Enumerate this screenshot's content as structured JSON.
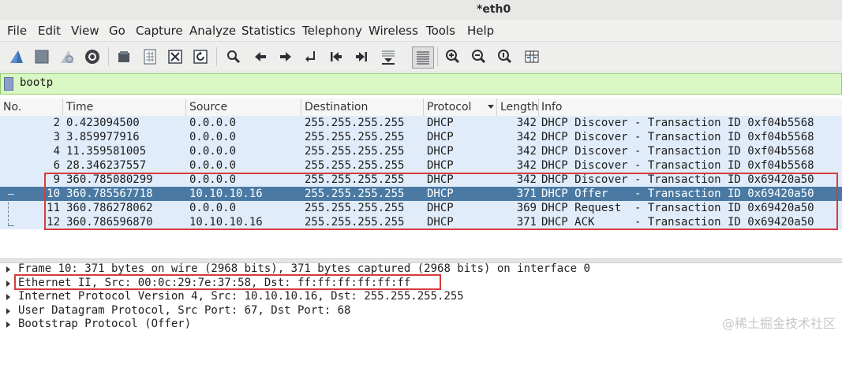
{
  "window": {
    "title": "*eth0"
  },
  "menu": [
    "File",
    "Edit",
    "View",
    "Go",
    "Capture",
    "Analyze",
    "Statistics",
    "Telephony",
    "Wireless",
    "Tools",
    "Help"
  ],
  "toolbar_icons": [
    "shark-fin-start-icon",
    "stop-square-icon",
    "shark-fin-restart-icon",
    "gear-options-icon",
    "open-folder-icon",
    "file-grid-icon",
    "close-file-icon",
    "reload-icon",
    "search-icon",
    "arrow-left-icon",
    "arrow-right-icon",
    "go-to-packet-icon",
    "first-packet-icon",
    "last-packet-icon",
    "autoscroll-icon",
    "colorize-icon",
    "zoom-in-icon",
    "zoom-out-icon",
    "zoom-normal-icon",
    "resize-columns-icon"
  ],
  "filter": {
    "value": "bootp"
  },
  "columns": {
    "no": "No.",
    "time": "Time",
    "source": "Source",
    "destination": "Destination",
    "protocol": "Protocol",
    "length": "Length",
    "info": "Info"
  },
  "packets": [
    {
      "no": "2",
      "time": "0.423094500",
      "source": "0.0.0.0",
      "destination": "255.255.255.255",
      "protocol": "DHCP",
      "length": "342",
      "info": "DHCP Discover - Transaction ID 0xf04b5568"
    },
    {
      "no": "3",
      "time": "3.859977916",
      "source": "0.0.0.0",
      "destination": "255.255.255.255",
      "protocol": "DHCP",
      "length": "342",
      "info": "DHCP Discover - Transaction ID 0xf04b5568"
    },
    {
      "no": "4",
      "time": "11.359581005",
      "source": "0.0.0.0",
      "destination": "255.255.255.255",
      "protocol": "DHCP",
      "length": "342",
      "info": "DHCP Discover - Transaction ID 0xf04b5568"
    },
    {
      "no": "6",
      "time": "28.346237557",
      "source": "0.0.0.0",
      "destination": "255.255.255.255",
      "protocol": "DHCP",
      "length": "342",
      "info": "DHCP Discover - Transaction ID 0xf04b5568"
    },
    {
      "no": "9",
      "time": "360.785080299",
      "source": "0.0.0.0",
      "destination": "255.255.255.255",
      "protocol": "DHCP",
      "length": "342",
      "info": "DHCP Discover - Transaction ID 0x69420a50"
    },
    {
      "no": "10",
      "time": "360.785567718",
      "source": "10.10.10.16",
      "destination": "255.255.255.255",
      "protocol": "DHCP",
      "length": "371",
      "info": "DHCP Offer    - Transaction ID 0x69420a50"
    },
    {
      "no": "11",
      "time": "360.786278062",
      "source": "0.0.0.0",
      "destination": "255.255.255.255",
      "protocol": "DHCP",
      "length": "369",
      "info": "DHCP Request  - Transaction ID 0x69420a50"
    },
    {
      "no": "12",
      "time": "360.786596870",
      "source": "10.10.10.16",
      "destination": "255.255.255.255",
      "protocol": "DHCP",
      "length": "371",
      "info": "DHCP ACK      - Transaction ID 0x69420a50"
    }
  ],
  "details": [
    "Frame 10: 371 bytes on wire (2968 bits), 371 bytes captured (2968 bits) on interface 0",
    "Ethernet II, Src: 00:0c:29:7e:37:58, Dst: ff:ff:ff:ff:ff:ff",
    "Internet Protocol Version 4, Src: 10.10.10.16, Dst: 255.255.255.255",
    "User Datagram Protocol, Src Port: 67, Dst Port: 68",
    "Bootstrap Protocol (Offer)"
  ],
  "watermark": "@稀土掘金技术社区",
  "colors": {
    "row_bg": "#e1ecfb",
    "selected_bg": "#4a7aa3",
    "filter_bg": "#d9f7c5",
    "highlight_box": "#d63c3c"
  }
}
